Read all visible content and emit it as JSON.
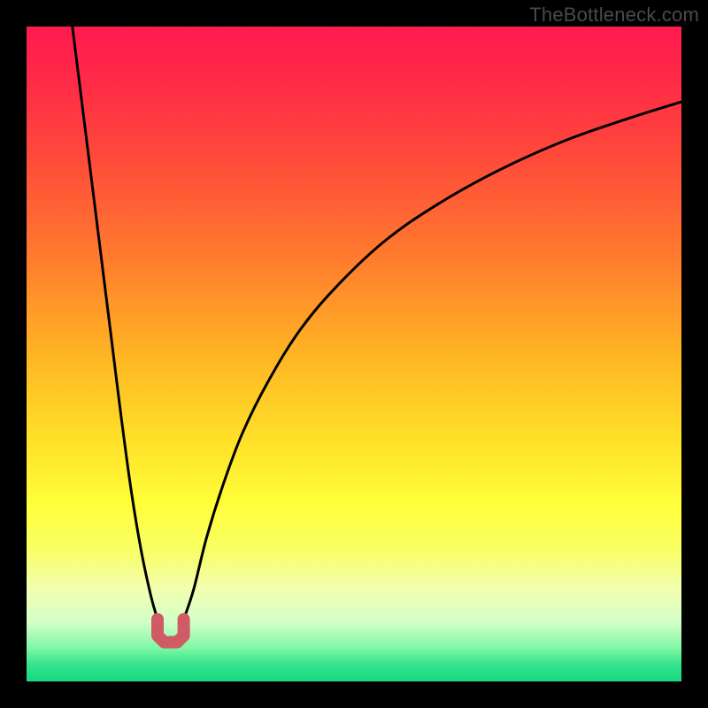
{
  "watermark": "TheBottleneck.com",
  "colors": {
    "frame": "#000000",
    "curve": "#000000",
    "marker": "#cf5b64",
    "gradient_stops": [
      {
        "offset": 0.0,
        "color": "#ff1a4f"
      },
      {
        "offset": 0.08,
        "color": "#ff2a47"
      },
      {
        "offset": 0.2,
        "color": "#ff4a3a"
      },
      {
        "offset": 0.35,
        "color": "#ff7a2e"
      },
      {
        "offset": 0.5,
        "color": "#ffb424"
      },
      {
        "offset": 0.63,
        "color": "#ffe028"
      },
      {
        "offset": 0.73,
        "color": "#ffff3a"
      },
      {
        "offset": 0.8,
        "color": "#f8ff66"
      },
      {
        "offset": 0.86,
        "color": "#f2ffb0"
      },
      {
        "offset": 0.91,
        "color": "#d3ffc8"
      },
      {
        "offset": 0.95,
        "color": "#7cf7a4"
      },
      {
        "offset": 0.975,
        "color": "#33e28e"
      },
      {
        "offset": 1.0,
        "color": "#18d880"
      }
    ]
  },
  "chart_data": {
    "type": "line",
    "title": "",
    "xlabel": "",
    "ylabel": "",
    "x_range": [
      0,
      100
    ],
    "y_range": [
      0,
      100
    ],
    "notch_x": 22,
    "notch_width": 4,
    "notch_bottom_y": 6.5,
    "series": [
      {
        "name": "left-branch",
        "x": [
          7.0,
          8.5,
          10.0,
          11.5,
          13.0,
          14.5,
          16.0,
          17.5,
          19.0,
          20.0
        ],
        "y": [
          100,
          88,
          76,
          64,
          52,
          40,
          29,
          20,
          13,
          9.5
        ]
      },
      {
        "name": "right-branch",
        "x": [
          24.0,
          25.5,
          27.5,
          30.0,
          33.0,
          37.0,
          42.0,
          48.0,
          55.0,
          63.0,
          72.0,
          82.0,
          92.0,
          100.0
        ],
        "y": [
          9.5,
          14,
          22,
          30,
          38,
          46,
          54,
          61,
          67.5,
          73,
          78,
          82.5,
          86,
          88.5
        ]
      },
      {
        "name": "notch-marker",
        "x": [
          20.0,
          20.0,
          21.0,
          23.0,
          24.0,
          24.0
        ],
        "y": [
          9.5,
          7.0,
          6.0,
          6.0,
          7.0,
          9.5
        ]
      }
    ]
  }
}
